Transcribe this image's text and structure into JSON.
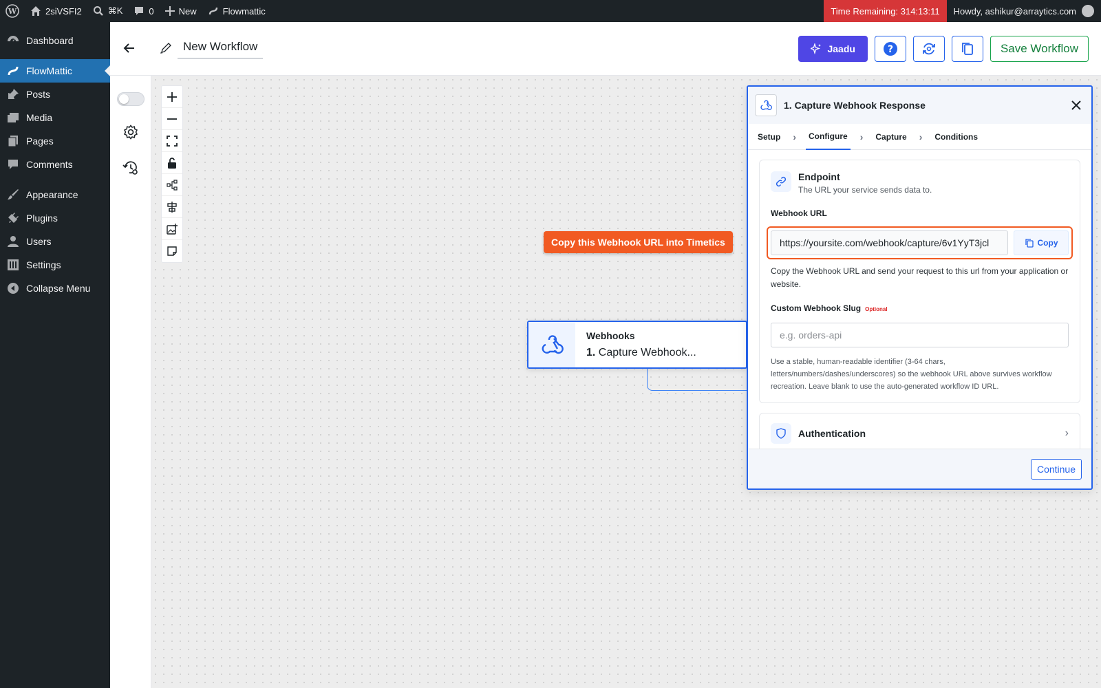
{
  "adminbar": {
    "site_name": "2siVSFI2",
    "search_shortcut": "⌘K",
    "comments_count": "0",
    "new_label": "New",
    "plugin_label": "Flowmattic",
    "timer": "Time Remaining: 314:13:11",
    "howdy": "Howdy, ashikur@arraytics.com"
  },
  "sidebar": {
    "items": [
      {
        "label": "Dashboard",
        "icon": "dashboard-icon"
      },
      {
        "label": "FlowMattic",
        "icon": "flowmattic-icon"
      },
      {
        "label": "Posts",
        "icon": "pin-icon"
      },
      {
        "label": "Media",
        "icon": "media-icon"
      },
      {
        "label": "Pages",
        "icon": "page-icon"
      },
      {
        "label": "Comments",
        "icon": "comment-icon"
      },
      {
        "label": "Appearance",
        "icon": "brush-icon"
      },
      {
        "label": "Plugins",
        "icon": "plug-icon"
      },
      {
        "label": "Users",
        "icon": "user-icon"
      },
      {
        "label": "Settings",
        "icon": "settings-icon"
      },
      {
        "label": "Collapse Menu",
        "icon": "collapse-icon"
      }
    ]
  },
  "header": {
    "workflow_title": "New Workflow",
    "jaadu_label": "Jaadu",
    "save_label": "Save Workflow"
  },
  "canvas": {
    "callout": "Copy this Webhook URL into Timetics",
    "node": {
      "app": "Webhooks",
      "step_number": "1.",
      "step_name": "Capture Webhook..."
    }
  },
  "panel": {
    "title": "1. Capture Webhook Response",
    "tabs": [
      "Setup",
      "Configure",
      "Capture",
      "Conditions"
    ],
    "active_tab": "Configure",
    "endpoint_title": "Endpoint",
    "endpoint_sub": "The URL your service sends data to.",
    "webhook_url_label": "Webhook URL",
    "webhook_url": "https://yoursite.com/webhook/capture/6v1YyT3jcl",
    "copy_label": "Copy",
    "url_help": "Copy the Webhook URL and send your request to this url from your application or website.",
    "slug_label": "Custom Webhook Slug",
    "slug_optional": "Optional",
    "slug_placeholder": "e.g. orders-api",
    "slug_help": "Use a stable, human-readable identifier (3-64 chars, letters/numbers/dashes/underscores) so the webhook URL above survives workflow recreation. Leave blank to use the auto-generated workflow ID URL.",
    "auth_title": "Authentication",
    "continue_label": "Continue"
  },
  "colors": {
    "wp_dark": "#1d2327",
    "wp_blue": "#2271b1",
    "accent_blue": "#2563eb",
    "jaadu_purple": "#4f46e5",
    "callout_orange": "#f15a22",
    "timer_red": "#d63638",
    "save_green": "#16a34a"
  }
}
